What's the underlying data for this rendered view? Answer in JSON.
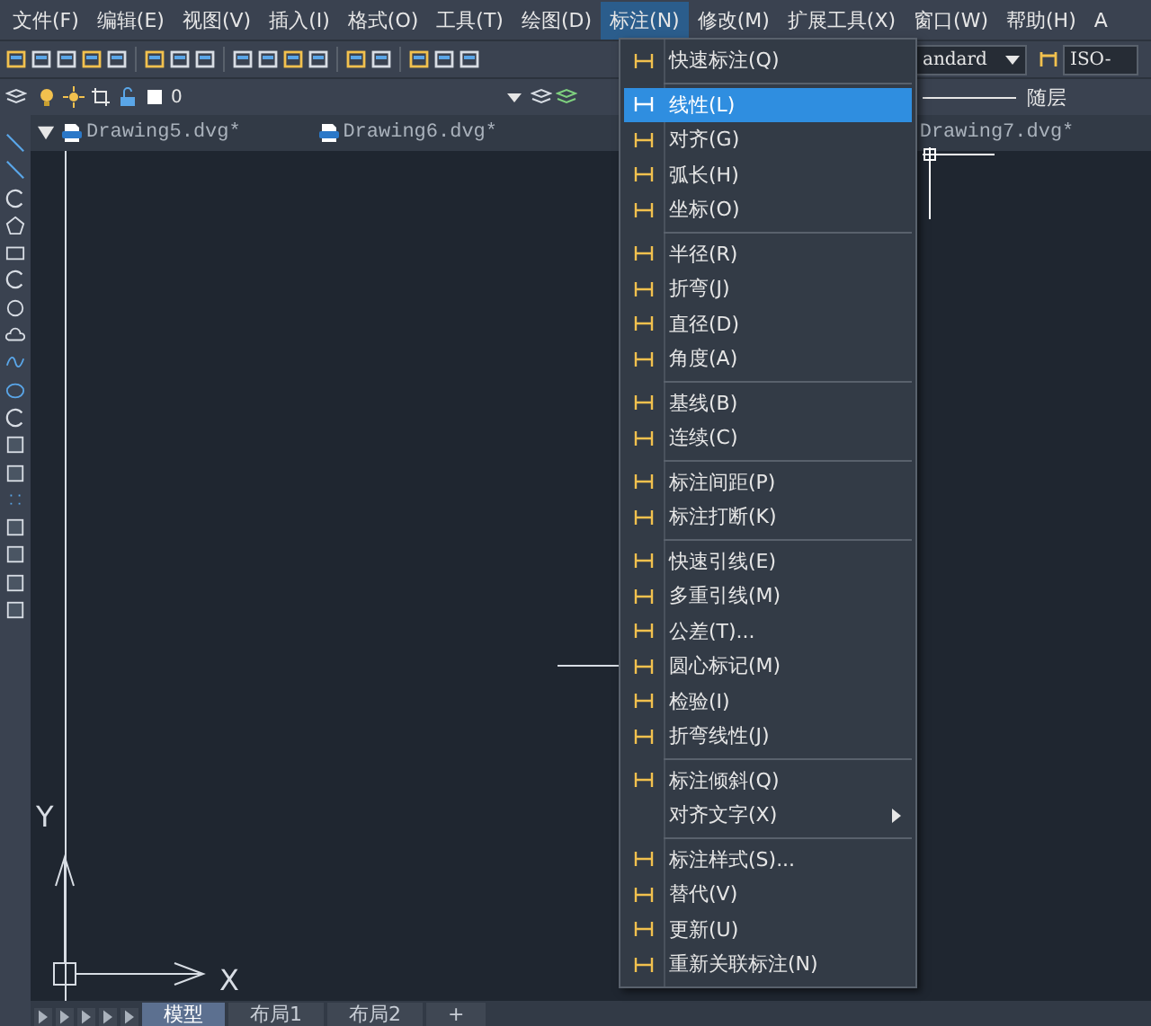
{
  "menubar": [
    {
      "label": "文件(F)",
      "selected": false
    },
    {
      "label": "编辑(E)",
      "selected": false
    },
    {
      "label": "视图(V)",
      "selected": false
    },
    {
      "label": "插入(I)",
      "selected": false
    },
    {
      "label": "格式(O)",
      "selected": false
    },
    {
      "label": "工具(T)",
      "selected": false
    },
    {
      "label": "绘图(D)",
      "selected": false
    },
    {
      "label": "标注(N)",
      "selected": true
    },
    {
      "label": "修改(M)",
      "selected": false
    },
    {
      "label": "扩展工具(X)",
      "selected": false
    },
    {
      "label": "窗口(W)",
      "selected": false
    },
    {
      "label": "帮助(H)",
      "selected": false
    },
    {
      "label": "A",
      "selected": false
    }
  ],
  "toolbar": {
    "style_combo": "andard",
    "dim_style_combo": "ISO-",
    "layer_combo": "0",
    "linetype": "随层"
  },
  "document_tabs": [
    {
      "label": "Drawing5.dvg*"
    },
    {
      "label": "Drawing6.dvg*"
    },
    {
      "label": "Drawing7.dvg*"
    }
  ],
  "dimension_menu": {
    "groups": [
      [
        {
          "label": "快速标注(Q)",
          "selected": false,
          "has_icon": true,
          "submenu": false
        }
      ],
      [
        {
          "label": "线性(L)",
          "selected": true,
          "has_icon": true,
          "submenu": false
        },
        {
          "label": "对齐(G)",
          "selected": false,
          "has_icon": true,
          "submenu": false
        },
        {
          "label": "弧长(H)",
          "selected": false,
          "has_icon": true,
          "submenu": false
        },
        {
          "label": "坐标(O)",
          "selected": false,
          "has_icon": true,
          "submenu": false
        }
      ],
      [
        {
          "label": "半径(R)",
          "selected": false,
          "has_icon": true,
          "submenu": false
        },
        {
          "label": "折弯(J)",
          "selected": false,
          "has_icon": true,
          "submenu": false
        },
        {
          "label": "直径(D)",
          "selected": false,
          "has_icon": true,
          "submenu": false
        },
        {
          "label": "角度(A)",
          "selected": false,
          "has_icon": true,
          "submenu": false
        }
      ],
      [
        {
          "label": "基线(B)",
          "selected": false,
          "has_icon": true,
          "submenu": false
        },
        {
          "label": "连续(C)",
          "selected": false,
          "has_icon": true,
          "submenu": false
        }
      ],
      [
        {
          "label": "标注间距(P)",
          "selected": false,
          "has_icon": true,
          "submenu": false
        },
        {
          "label": "标注打断(K)",
          "selected": false,
          "has_icon": true,
          "submenu": false
        }
      ],
      [
        {
          "label": "快速引线(E)",
          "selected": false,
          "has_icon": true,
          "submenu": false
        },
        {
          "label": "多重引线(M)",
          "selected": false,
          "has_icon": true,
          "submenu": false
        },
        {
          "label": "公差(T)...",
          "selected": false,
          "has_icon": true,
          "submenu": false
        },
        {
          "label": "圆心标记(M)",
          "selected": false,
          "has_icon": true,
          "submenu": false
        },
        {
          "label": "检验(I)",
          "selected": false,
          "has_icon": true,
          "submenu": false
        },
        {
          "label": "折弯线性(J)",
          "selected": false,
          "has_icon": true,
          "submenu": false
        }
      ],
      [
        {
          "label": "标注倾斜(Q)",
          "selected": false,
          "has_icon": true,
          "submenu": false
        },
        {
          "label": "对齐文字(X)",
          "selected": false,
          "has_icon": false,
          "submenu": true
        }
      ],
      [
        {
          "label": "标注样式(S)...",
          "selected": false,
          "has_icon": true,
          "submenu": false
        },
        {
          "label": "替代(V)",
          "selected": false,
          "has_icon": true,
          "submenu": false
        },
        {
          "label": "更新(U)",
          "selected": false,
          "has_icon": true,
          "submenu": false
        },
        {
          "label": "重新关联标注(N)",
          "selected": false,
          "has_icon": true,
          "submenu": false
        }
      ]
    ]
  },
  "ucs": {
    "x_label": "X",
    "y_label": "Y"
  },
  "layout_tabs": [
    {
      "label": "模型",
      "selected": true
    },
    {
      "label": "布局1",
      "selected": false
    },
    {
      "label": "布局2",
      "selected": false
    },
    {
      "label": "+",
      "selected": false
    }
  ]
}
